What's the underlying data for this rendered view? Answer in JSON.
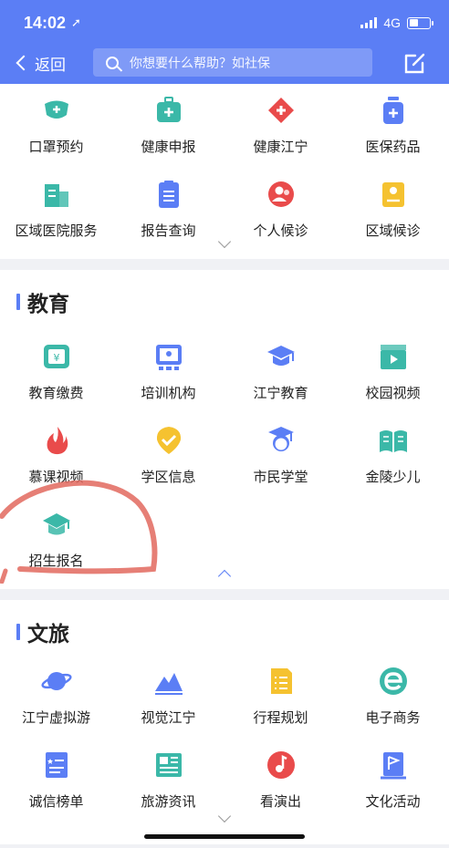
{
  "status_bar": {
    "time": "14:02",
    "network": "4G"
  },
  "nav": {
    "back_label": "返回",
    "search_placeholder": "你想要什么帮助？如社保"
  },
  "health": {
    "items": [
      {
        "label": "口罩预约",
        "icon": "mask-icon",
        "color": "#3bb8a8"
      },
      {
        "label": "健康申报",
        "icon": "medical-kit-icon",
        "color": "#3bb8a8"
      },
      {
        "label": "健康江宁",
        "icon": "red-cross-icon",
        "color": "#e94b4b"
      },
      {
        "label": "医保药品",
        "icon": "medicine-bottle-icon",
        "color": "#5b7ef5"
      },
      {
        "label": "区域医院服务",
        "icon": "hospital-icon",
        "color": "#3bb8a8"
      },
      {
        "label": "报告查询",
        "icon": "report-icon",
        "color": "#5b7ef5"
      },
      {
        "label": "个人候诊",
        "icon": "person-icon",
        "color": "#e94b4b"
      },
      {
        "label": "区域候诊",
        "icon": "id-card-icon",
        "color": "#f5c230"
      }
    ]
  },
  "education": {
    "title": "教育",
    "items": [
      {
        "label": "教育缴费",
        "icon": "payment-icon",
        "color": "#3bb8a8"
      },
      {
        "label": "培训机构",
        "icon": "training-board-icon",
        "color": "#5b7ef5"
      },
      {
        "label": "江宁教育",
        "icon": "graduation-cap-icon",
        "color": "#5b7ef5"
      },
      {
        "label": "校园视频",
        "icon": "video-clapper-icon",
        "color": "#3bb8a8"
      },
      {
        "label": "慕课视频",
        "icon": "flame-icon",
        "color": "#e94b4b"
      },
      {
        "label": "学区信息",
        "icon": "location-pin-icon",
        "color": "#f5c230"
      },
      {
        "label": "市民学堂",
        "icon": "student-icon",
        "color": "#5b7ef5"
      },
      {
        "label": "金陵少儿",
        "icon": "open-book-icon",
        "color": "#3bb8a8"
      },
      {
        "label": "招生报名",
        "icon": "mortarboard-icon",
        "color": "#3bb8a8"
      }
    ]
  },
  "culture": {
    "title": "文旅",
    "items": [
      {
        "label": "江宁虚拟游",
        "icon": "planet-icon",
        "color": "#5b7ef5"
      },
      {
        "label": "视觉江宁",
        "icon": "mountain-icon",
        "color": "#5b7ef5"
      },
      {
        "label": "行程规划",
        "icon": "itinerary-icon",
        "color": "#f5c230"
      },
      {
        "label": "电子商务",
        "icon": "e-commerce-icon",
        "color": "#3bb8a8"
      },
      {
        "label": "诚信榜单",
        "icon": "ranking-list-icon",
        "color": "#5b7ef5"
      },
      {
        "label": "旅游资讯",
        "icon": "news-icon",
        "color": "#3bb8a8"
      },
      {
        "label": "看演出",
        "icon": "music-note-icon",
        "color": "#e94b4b"
      },
      {
        "label": "文化活动",
        "icon": "culture-activity-icon",
        "color": "#5b7ef5"
      }
    ]
  }
}
